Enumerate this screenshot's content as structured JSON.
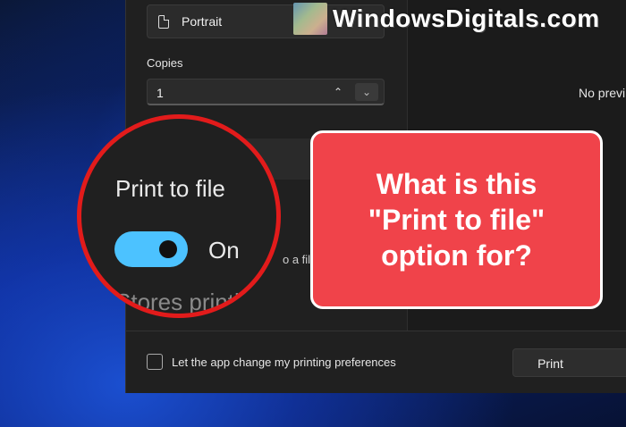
{
  "print_dialog": {
    "orientation": {
      "value": "Portrait",
      "icon": "page-orientation-icon"
    },
    "copies": {
      "label": "Copies",
      "value": "1",
      "increase_icon": "chevron-up-icon",
      "decrease_icon": "chevron-down-icon"
    },
    "preview": {
      "text": "No previ"
    },
    "print_to_file_partial_text": "o a file",
    "footer": {
      "checkbox_checked": false,
      "checkbox_label": "Let the app change my printing preferences",
      "print_button_label": "Print"
    }
  },
  "zoom_callout": {
    "label": "Print to file",
    "toggle_on": true,
    "toggle_state_text": "On",
    "description_partial": "Stores printi",
    "accent_color": "#4cc2ff",
    "ring_color": "#e21b1b"
  },
  "callout_box": {
    "text": "What is this\n\"Print to file\"\noption for?",
    "background_color": "#f0434a"
  },
  "watermark": {
    "text": "WindowsDigitals.com"
  }
}
